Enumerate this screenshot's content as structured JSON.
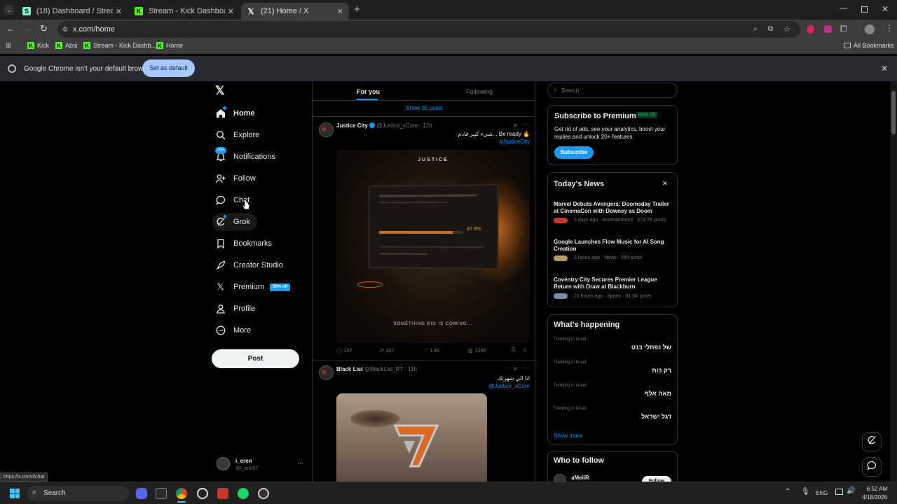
{
  "tabs": [
    {
      "title": "(18) Dashboard / Streamlabs",
      "icon": "streamlabs-icon"
    },
    {
      "title": "Stream - Kick Dashboard",
      "icon": "kick-icon"
    },
    {
      "title": "(21) Home / X",
      "icon": "x-icon"
    }
  ],
  "address": "x.com/home",
  "bookmarks": [
    "Kick",
    "Absi",
    "Stream - Kick Dashb...",
    "Home"
  ],
  "all_bookmarks": "All Bookmarks",
  "infobar": {
    "message": "Google Chrome isn't your default browser",
    "button": "Set as default"
  },
  "nav": {
    "items": [
      "Home",
      "Explore",
      "Notifications",
      "Follow",
      "Chat",
      "Grok",
      "Bookmarks",
      "Creator Studio",
      "Premium",
      "Profile",
      "More"
    ],
    "notif_badge": "20+",
    "premium_badge": "50% off",
    "post": "Post",
    "user": {
      "name": "i_eren",
      "handle": "@i_erin67"
    }
  },
  "feed": {
    "tab_for_you": "For you",
    "tab_following": "Following",
    "show_posts": "Show 35 posts",
    "posts": [
      {
        "name": "Justice City",
        "handle": "@Justice_xCore · 12h",
        "text": "شيء كبير قادم... Be ready 🔥",
        "hashtag": "#JusticeCity",
        "image_caption": "SOMETHING BIG IS COMING...",
        "image_logo": "JUSTICE",
        "progress": "87.9%",
        "stats": {
          "replies": "197",
          "reposts": "337",
          "likes": "1.4K",
          "views": "128K"
        }
      },
      {
        "name": "Black List",
        "handle": "@BlackList_RT · 11h",
        "text": "انا الي شهرتك",
        "mention": "@Justice_xCore"
      }
    ]
  },
  "right": {
    "search_placeholder": "Search",
    "premium": {
      "title": "Subscribe to Premium",
      "badge": "50% off",
      "body": "Get rid of ads, see your analytics, boost your replies and unlock 20+ features.",
      "button": "Subscribe"
    },
    "news": {
      "title": "Today's News",
      "items": [
        {
          "headline": "Marvel Debuts Avengers: Doomsday Trailer at CinemaCon with Downey as Doom",
          "meta": "5 days ago · Entertainment · 373.7K posts"
        },
        {
          "headline": "Google Launches Flow Music for AI Song Creation",
          "meta": "3 hours ago · News · 265 posts"
        },
        {
          "headline": "Coventry City Secures Premier League Return with Draw at Blackburn",
          "meta": "21 hours ago · Sports · 81.6K posts"
        }
      ]
    },
    "happening": {
      "title": "What's happening",
      "trends": [
        {
          "context": "Trending in Israel",
          "name": "של נפתלי בנט"
        },
        {
          "context": "Trending in Israel",
          "name": "רק כוח"
        },
        {
          "context": "Trending in Israel",
          "name": "מאה אלף"
        },
        {
          "context": "Trending in Israel",
          "name": "דגל ישראל"
        }
      ],
      "show_more": "Show more"
    },
    "who_to_follow": {
      "title": "Who to follow",
      "user": "aMeiiR",
      "button": "Follow"
    }
  },
  "status_url": "https://x.com/i/chat",
  "taskbar": {
    "search": "Search",
    "lang": "ENG",
    "time": "6:52 AM",
    "date": "4/18/2026"
  }
}
